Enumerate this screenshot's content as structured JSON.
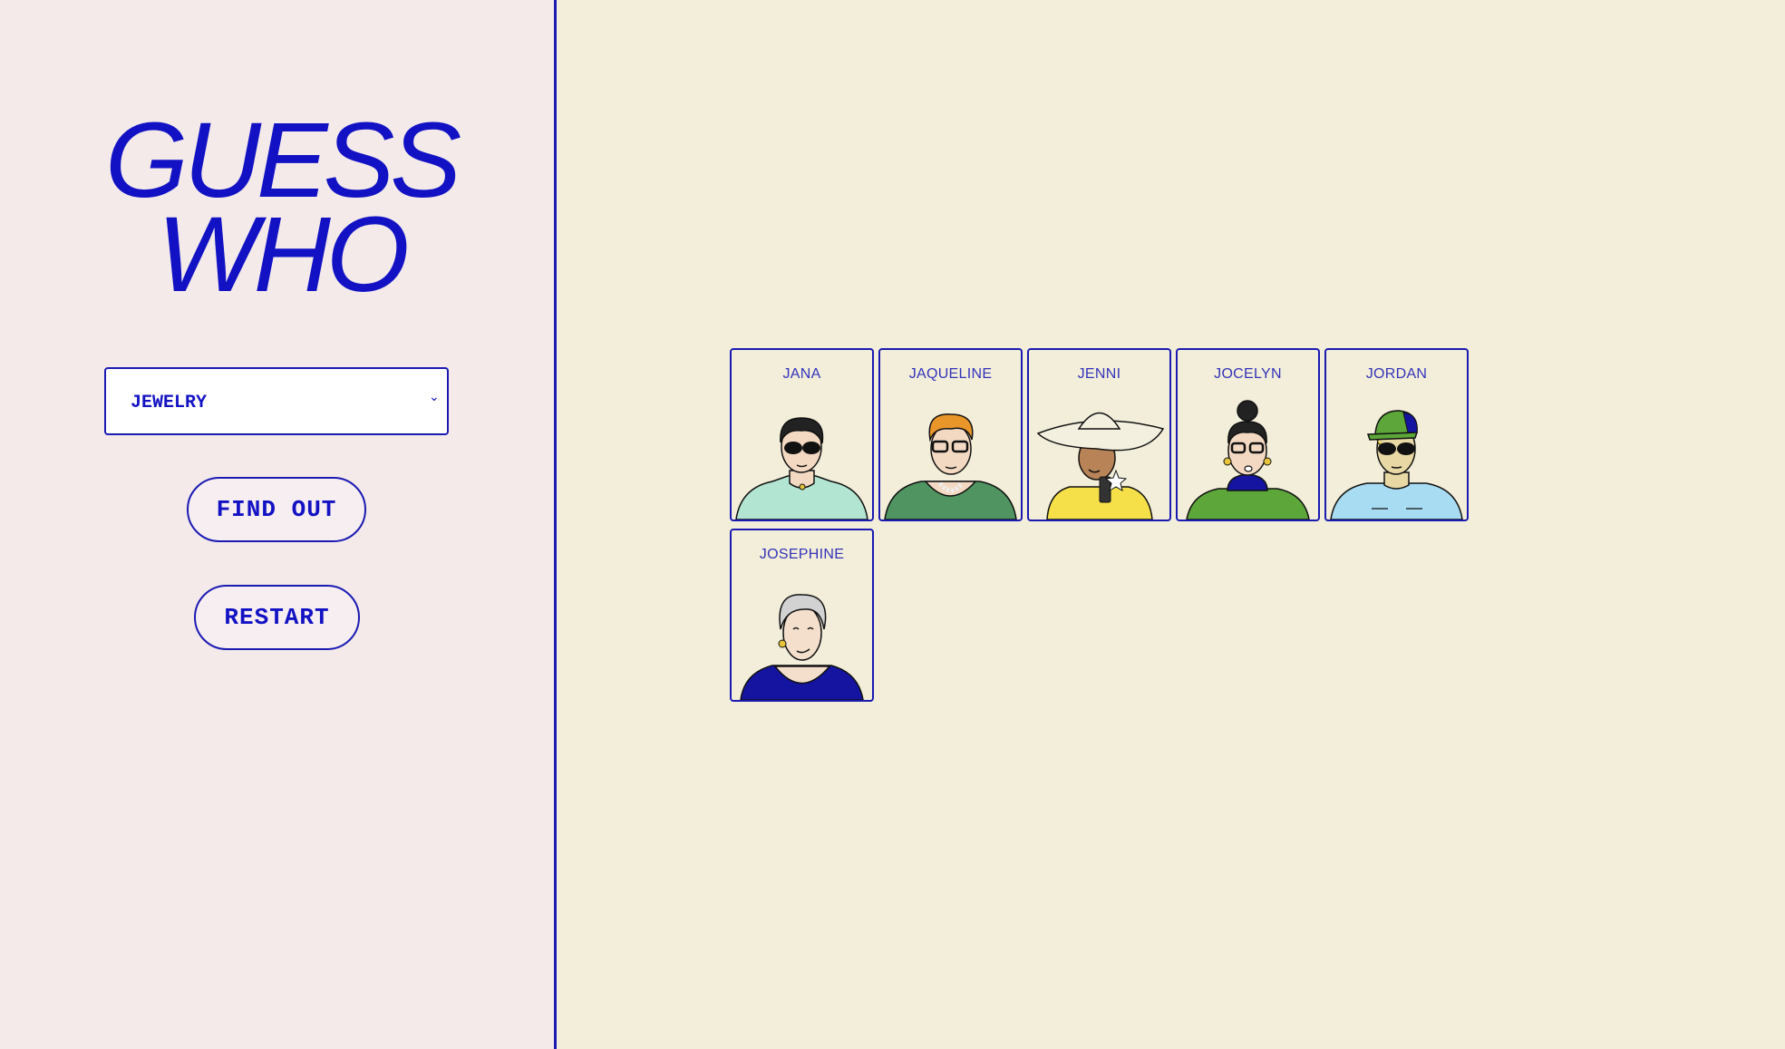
{
  "sidebar": {
    "title_line1": "GUESS",
    "title_line2": "WHO",
    "question_select": {
      "selected": "JEWELRY"
    },
    "find_out_label": "FIND OUT",
    "restart_label": "RESTART"
  },
  "board": {
    "cards": [
      {
        "name": "JANA"
      },
      {
        "name": "JAQUELINE"
      },
      {
        "name": "JENNI"
      },
      {
        "name": "JOCELYN"
      },
      {
        "name": "JORDAN"
      },
      {
        "name": "JOSEPHINE"
      }
    ]
  },
  "colors": {
    "accent": "#1212c4",
    "sidebar_bg": "#f4eaea",
    "board_bg": "#f3eed9"
  }
}
